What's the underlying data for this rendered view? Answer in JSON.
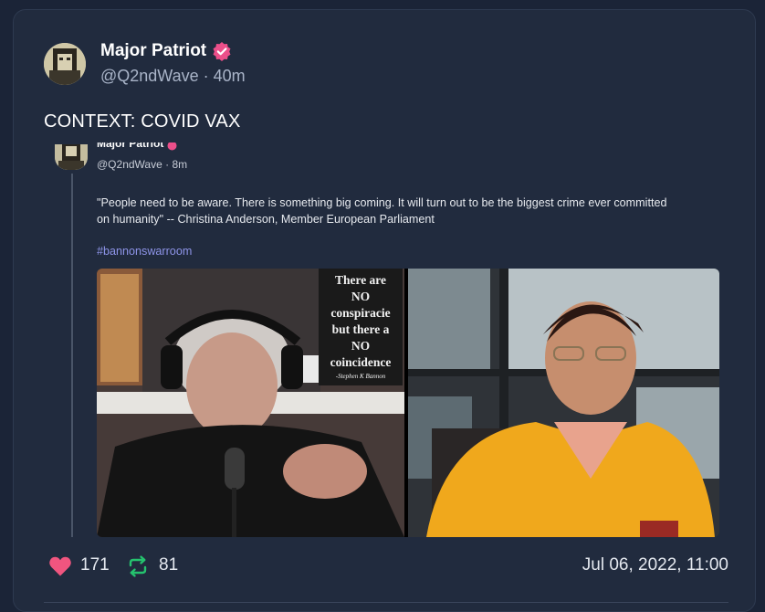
{
  "post": {
    "author_name": "Major Patriot",
    "handle": "@Q2ndWave",
    "separator": " · ",
    "age": "40m",
    "text": "CONTEXT:  COVID VAX",
    "icons": {
      "avatar": "avatar-image",
      "verified": "verified-badge-icon"
    }
  },
  "embedded_post": {
    "author_name": "Major Patriot",
    "handle": "@Q2ndWave",
    "age": "8m",
    "quote": "\"People need to be aware.  There is something big coming.  It will turn out to be the biggest crime ever committed on humanity\" -- Christina Anderson, Member European Parliament",
    "hashtag": "#bannonswarroom",
    "media": {
      "sign_lines": [
        "There are",
        "NO",
        "conspiracie",
        "but there a",
        "NO",
        "coincidence"
      ],
      "sign_signature": "-Stephen K Bannon"
    }
  },
  "footer": {
    "likes": "171",
    "reposts": "81",
    "timestamp": "Jul 06, 2022, 11:00",
    "icons": {
      "like": "heart-icon",
      "repost": "repost-icon"
    }
  },
  "colors": {
    "background": "#1b2437",
    "card": "#212b3e",
    "verified": "#ec4f8a",
    "like": "#f0557f",
    "repost": "#25c26e",
    "hashtag": "#8e94e8",
    "muted_text": "#a9b4c8"
  }
}
